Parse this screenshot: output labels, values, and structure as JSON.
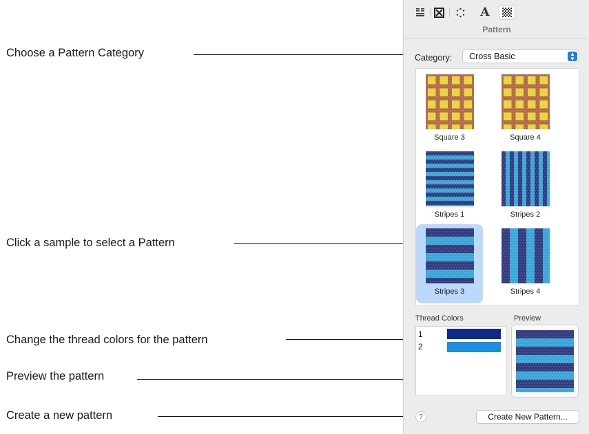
{
  "callouts": [
    {
      "text": "Choose a Pattern Category"
    },
    {
      "text": "Click a sample to select a Pattern"
    },
    {
      "text": "Change the thread colors for the pattern"
    },
    {
      "text": "Preview the pattern"
    },
    {
      "text": "Create a new pattern"
    }
  ],
  "toolbar": {
    "icons": [
      "properties-icon",
      "stitch-type-icon",
      "dotted-circle-icon",
      "text-icon",
      "pattern-icon"
    ],
    "text_glyph": "A",
    "active": "pattern-icon"
  },
  "panel": {
    "title": "Pattern",
    "category_label": "Category:",
    "category_value": "Cross Basic",
    "patterns": [
      {
        "label": "Square 3",
        "style": "square",
        "selected": false
      },
      {
        "label": "Square 4",
        "style": "square",
        "selected": false
      },
      {
        "label": "Stripes 1",
        "style": "hstripes",
        "selected": false
      },
      {
        "label": "Stripes 2",
        "style": "vstripes",
        "selected": false
      },
      {
        "label": "Stripes 3",
        "style": "hbands",
        "selected": true
      },
      {
        "label": "Stripes 4",
        "style": "vbands",
        "selected": false
      },
      {
        "label": "",
        "style": "hbands",
        "selected": false
      },
      {
        "label": "",
        "style": "vbands",
        "selected": false
      }
    ],
    "thread_colors_label": "Thread Colors",
    "thread_colors": [
      {
        "num": "1",
        "color": "#0b2a8c"
      },
      {
        "num": "2",
        "color": "#1d8ee0"
      }
    ],
    "preview_label": "Preview",
    "help_glyph": "?",
    "create_button": "Create New Pattern..."
  },
  "colors": {
    "square_bg": "#b4694a",
    "square_fill": "#e6d63a",
    "stripe_dark": "#343a7e",
    "stripe_light": "#3aa6d8",
    "selection": "#bcd9fb",
    "accent": "#1a7fe0"
  }
}
